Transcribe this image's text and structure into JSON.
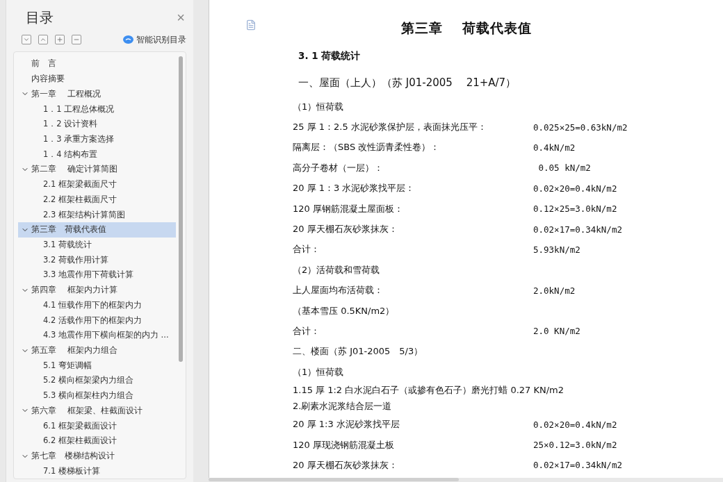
{
  "outline": {
    "title": "目录",
    "close": "×",
    "smart_button": "智能识别目录",
    "items": [
      {
        "label": "前　言",
        "selected": false
      },
      {
        "label": "内容摘要",
        "selected": false
      },
      {
        "label": "第一章　 工程概况",
        "selected": false,
        "expanded": true,
        "children": [
          {
            "label": "1．1 工程总体概况",
            "selected": false
          },
          {
            "label": "1．2 设计资料",
            "selected": false
          },
          {
            "label": "1．3 承重方案选择",
            "selected": false
          },
          {
            "label": "1．4 结构布置",
            "selected": false
          }
        ]
      },
      {
        "label": "第二章　 确定计算简图",
        "selected": false,
        "expanded": true,
        "children": [
          {
            "label": "2.1 框架梁截面尺寸",
            "selected": false
          },
          {
            "label": "2.2 框架柱截面尺寸",
            "selected": false
          },
          {
            "label": "2.3 框架结构计算简图",
            "selected": false
          }
        ]
      },
      {
        "label": "第三章　荷载代表值",
        "selected": true,
        "expanded": true,
        "children": [
          {
            "label": "3.1 荷载统计",
            "selected": false
          },
          {
            "label": "3.2 荷载作用计算",
            "selected": false
          },
          {
            "label": "3.3 地震作用下荷载计算",
            "selected": false
          }
        ]
      },
      {
        "label": "第四章　 框架内力计算",
        "selected": false,
        "expanded": true,
        "children": [
          {
            "label": "4.1 恒载作用下的框架内力",
            "selected": false
          },
          {
            "label": "4.2 活载作用下的框架内力",
            "selected": false
          },
          {
            "label": "4.3 地震作用下横向框架的内力 ...",
            "selected": false
          }
        ]
      },
      {
        "label": "第五章　 框架内力组合",
        "selected": false,
        "expanded": true,
        "children": [
          {
            "label": "5.1 弯矩调幅",
            "selected": false
          },
          {
            "label": "5.2 横向框架梁内力组合",
            "selected": false
          },
          {
            "label": "5.3 横向框架柱内力组合",
            "selected": false
          }
        ]
      },
      {
        "label": "第六章　 框架梁、柱截面设计",
        "selected": false,
        "expanded": true,
        "children": [
          {
            "label": "6.1 框架梁截面设计",
            "selected": false
          },
          {
            "label": "6.2 框架柱截面设计",
            "selected": false
          }
        ]
      },
      {
        "label": "第七章　楼梯结构设计",
        "selected": false,
        "expanded": true,
        "children": [
          {
            "label": "7.1 楼梯板计算",
            "selected": false
          }
        ]
      }
    ]
  },
  "document": {
    "title": "第三章　 荷载代表值",
    "lines": [
      {
        "kind": "section",
        "text": "3. 1 荷载统计"
      },
      {
        "kind": "subsection",
        "text": "一、屋面（上人）（苏 J01-2005　 21+A/7）"
      },
      {
        "kind": "text",
        "text": "（1）恒荷载"
      },
      {
        "kind": "row",
        "text": "25 厚 1：2.5 水泥砂浆保护层，表面抹光压平：",
        "value": "0.025×25=0.63kN/m2"
      },
      {
        "kind": "row",
        "text": "隔离层：（SBS 改性沥青柔性卷）：",
        "value": "0.4kN/m2"
      },
      {
        "kind": "row",
        "text": "高分子卷材（一层）：",
        "value": " 0.05 kN/m2"
      },
      {
        "kind": "row",
        "text": "20 厚 1：3 水泥砂浆找平层：",
        "value": "0.02×20=0.4kN/m2"
      },
      {
        "kind": "row",
        "text": "120 厚钢筋混凝土屋面板：",
        "value": "0.12×25=3.0kN/m2"
      },
      {
        "kind": "row",
        "text": "20 厚天棚石灰砂浆抹灰：",
        "value": "0.02×17=0.34kN/m2"
      },
      {
        "kind": "row",
        "text": "合计：",
        "value": "5.93kN/m2"
      },
      {
        "kind": "text",
        "text": "（2）活荷载和雪荷载"
      },
      {
        "kind": "row",
        "text": "上人屋面均布活荷载：",
        "value": "2.0kN/m2"
      },
      {
        "kind": "text",
        "text": "（基本雪压 0.5KN/m2）"
      },
      {
        "kind": "row",
        "text": "合计：",
        "value": "2.0 KN/m2"
      },
      {
        "kind": "text",
        "text": "二、楼面（苏 J01-2005　5/3）"
      },
      {
        "kind": "text",
        "text": "（1）恒荷载"
      },
      {
        "kind": "tight",
        "text": "1.15 厚 1:2 白水泥白石子（或掺有色石子）磨光打蜡 0.27 KN/m2"
      },
      {
        "kind": "tight",
        "text": "2.刷素水泥浆结合层一道"
      },
      {
        "kind": "row",
        "text": "20 厚 1:3 水泥砂浆找平层",
        "value": "0.02×20=0.4kN/m2"
      },
      {
        "kind": "row",
        "text": "120 厚现浇钢筋混凝土板",
        "value": "25×0.12=3.0kN/m2"
      },
      {
        "kind": "row",
        "text": "20 厚天棚石灰砂浆抹灰：",
        "value": "0.02×17=0.34kN/m2"
      }
    ]
  }
}
